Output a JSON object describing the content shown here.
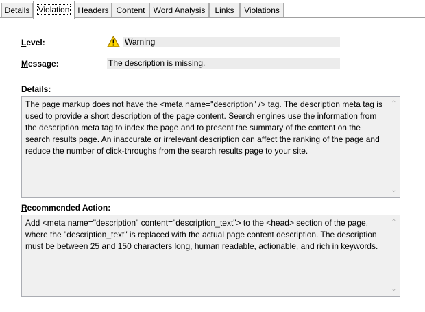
{
  "tabs": [
    {
      "label": "Details"
    },
    {
      "label": "Violation"
    },
    {
      "label": "Headers"
    },
    {
      "label": "Content"
    },
    {
      "label": "Word Analysis"
    },
    {
      "label": "Links"
    },
    {
      "label": "Violations"
    }
  ],
  "active_tab": "Violation",
  "level": {
    "label_accel": "L",
    "label_rest": "evel:",
    "value": "Warning",
    "icon": "warning-icon"
  },
  "message": {
    "label_accel": "M",
    "label_rest": "essage:",
    "value": "The description is missing."
  },
  "details": {
    "label_accel": "D",
    "label_rest": "etails:",
    "text": "The page markup does not have the <meta name=\"description\" /> tag. The description meta tag is used to provide a short description of the page content. Search engines use the information from the description meta tag to index the page and to present the summary of the content on the search results page. An inaccurate or irrelevant description can affect the ranking of the page and reduce the number of click-throughs from the search results page to your site."
  },
  "recommended_action": {
    "label_accel": "R",
    "label_rest": "ecommended Action:",
    "text": "Add <meta name=\"description\" content=\"description_text\"> to the <head> section of the page, where the \"description_text\" is replaced with the actual page content description. The description must be between 25 and 150 characters long, human readable, actionable, and rich in keywords."
  },
  "colors": {
    "warning_fill": "#ffd700",
    "warning_stroke": "#a07800",
    "field_bg": "#ececec",
    "textbox_bg": "#f0f0f0"
  }
}
